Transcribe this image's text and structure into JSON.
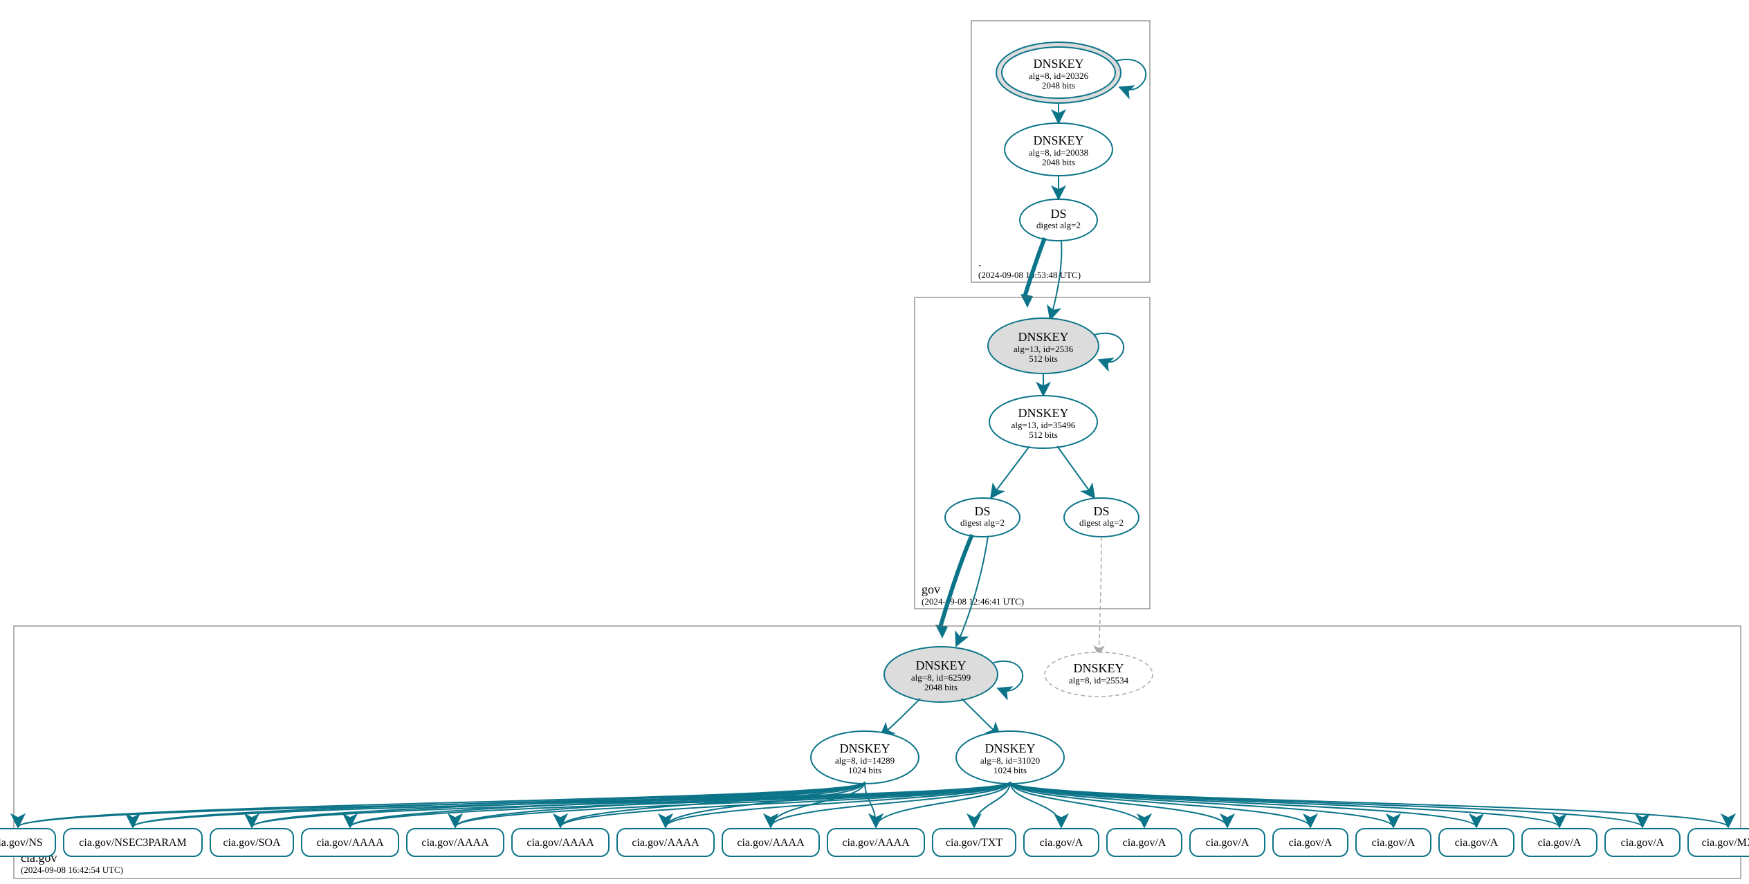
{
  "colors": {
    "accent": "#0c7489",
    "node_fill": "#dcdcdc",
    "grey": "#aaaaaa"
  },
  "zones": {
    "root": {
      "label": ".",
      "timestamp": "(2024-09-08 10:53:48 UTC)"
    },
    "gov": {
      "label": "gov",
      "timestamp": "(2024-09-08 12:46:41 UTC)"
    },
    "cia": {
      "label": "cia.gov",
      "timestamp": "(2024-09-08 16:42:54 UTC)"
    }
  },
  "nodes": {
    "root_ksk": {
      "title": "DNSKEY",
      "sub1": "alg=8, id=20326",
      "sub2": "2048 bits"
    },
    "root_zsk": {
      "title": "DNSKEY",
      "sub1": "alg=8, id=20038",
      "sub2": "2048 bits"
    },
    "root_ds": {
      "title": "DS",
      "sub1": "digest alg=2"
    },
    "gov_ksk": {
      "title": "DNSKEY",
      "sub1": "alg=13, id=2536",
      "sub2": "512 bits"
    },
    "gov_zsk": {
      "title": "DNSKEY",
      "sub1": "alg=13, id=35496",
      "sub2": "512 bits"
    },
    "gov_ds1": {
      "title": "DS",
      "sub1": "digest alg=2"
    },
    "gov_ds2": {
      "title": "DS",
      "sub1": "digest alg=2"
    },
    "cia_ksk": {
      "title": "DNSKEY",
      "sub1": "alg=8, id=62599",
      "sub2": "2048 bits"
    },
    "cia_grey": {
      "title": "DNSKEY",
      "sub1": "alg=8, id=25534"
    },
    "cia_zsk1": {
      "title": "DNSKEY",
      "sub1": "alg=8, id=14289",
      "sub2": "1024 bits"
    },
    "cia_zsk2": {
      "title": "DNSKEY",
      "sub1": "alg=8, id=31020",
      "sub2": "1024 bits"
    }
  },
  "rr": [
    "cia.gov/NS",
    "cia.gov/NSEC3PARAM",
    "cia.gov/SOA",
    "cia.gov/AAAA",
    "cia.gov/AAAA",
    "cia.gov/AAAA",
    "cia.gov/AAAA",
    "cia.gov/AAAA",
    "cia.gov/AAAA",
    "cia.gov/TXT",
    "cia.gov/A",
    "cia.gov/A",
    "cia.gov/A",
    "cia.gov/A",
    "cia.gov/A",
    "cia.gov/A",
    "cia.gov/A",
    "cia.gov/A",
    "cia.gov/MX"
  ]
}
